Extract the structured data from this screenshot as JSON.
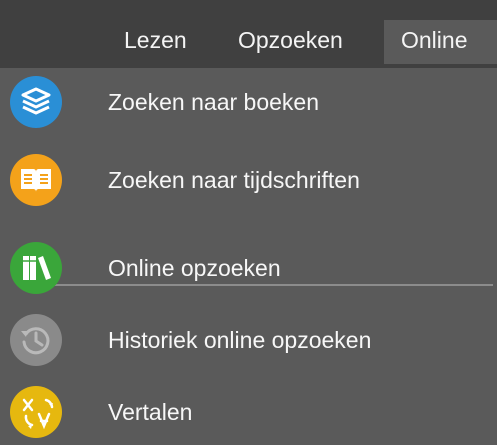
{
  "tabs": [
    {
      "label": "Lezen"
    },
    {
      "label": "Opzoeken"
    },
    {
      "label": "Online",
      "active": true
    }
  ],
  "items": [
    {
      "label": "Zoeken naar boeken",
      "icon": "books-icon",
      "color": "#2a8fd6",
      "enabled": true
    },
    {
      "label": "Zoeken naar tijdschriften",
      "icon": "open-book-icon",
      "color": "#f4a21a",
      "enabled": true
    },
    {
      "label": "Online opzoeken",
      "icon": "library-books-icon",
      "color": "#3aa63a",
      "enabled": true
    },
    {
      "label": "Historiek online opzoeken",
      "icon": "history-icon",
      "color": "#8a8a8a",
      "enabled": false
    },
    {
      "label": "Vertalen",
      "icon": "translate-icon",
      "color": "#e6b80f",
      "enabled": true
    }
  ],
  "colors": {
    "top_bar": "#404040",
    "menu_bg": "#5a5a5a",
    "divider": "#8c8c8c"
  }
}
